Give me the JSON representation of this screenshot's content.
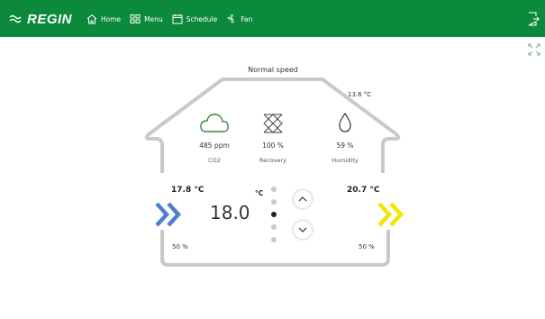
{
  "header": {
    "logo_text": "REGIN",
    "nav": [
      {
        "label": "Home",
        "icon": "home-icon"
      },
      {
        "label": "Menu",
        "icon": "menu-grid-icon"
      },
      {
        "label": "Schedule",
        "icon": "calendar-icon"
      },
      {
        "label": "Fan",
        "icon": "fan-icon"
      }
    ],
    "right_icon": "logout-icon"
  },
  "colors": {
    "header_bg": "#0b8a3b",
    "house_outline": "#c9c9c9",
    "co2_icon": "#3a8a3e",
    "supply_arrow": "#4f7fc8",
    "extract_arrow": "#f3e600"
  },
  "main": {
    "fan_speed": "Normal speed",
    "outdoor_temp": "13.6 °C",
    "sensors": [
      {
        "value": "485 ppm",
        "label": "CO2",
        "icon": "cloud-icon"
      },
      {
        "value": "100 %",
        "label": "Recovery",
        "icon": "heat-exchanger-icon"
      },
      {
        "value": "59 %",
        "label": "Humidity",
        "icon": "droplet-icon"
      }
    ],
    "supply_temp": "17.8 °C",
    "extract_temp": "20.7 °C",
    "setpoint_unit": "°C",
    "setpoint": "18.0",
    "supply_fan_pct": "50 %",
    "extract_fan_pct": "50 %",
    "setpoint_options_count": 5,
    "setpoint_selected_index": 2
  }
}
